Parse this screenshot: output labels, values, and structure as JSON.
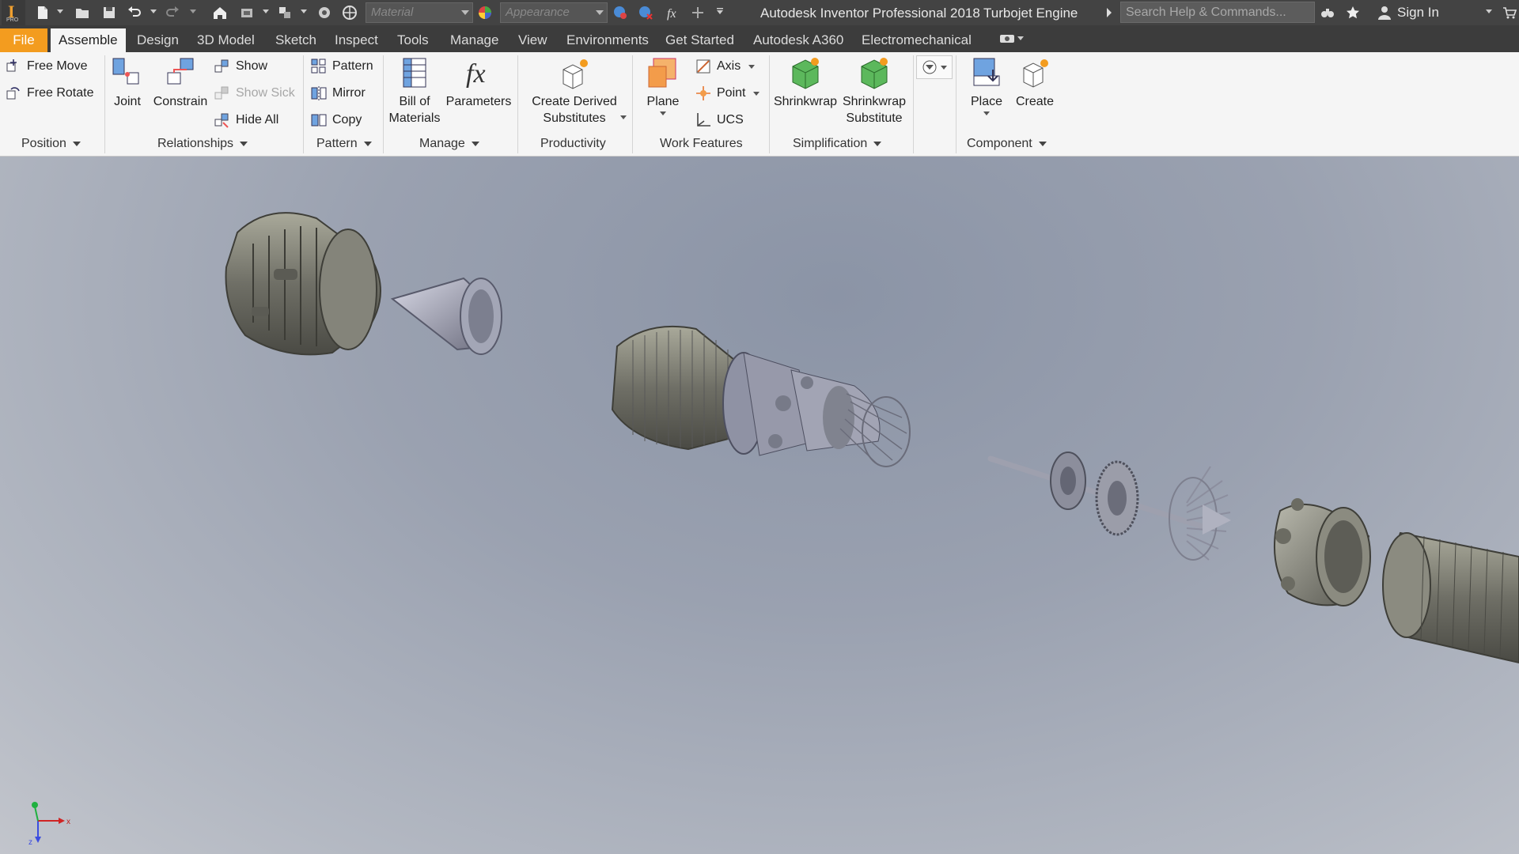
{
  "app": {
    "title": "Autodesk Inventor Professional 2018",
    "document": "Turbojet Engine",
    "logo_letter": "I",
    "logo_sub": "PRO"
  },
  "quick_access": {
    "material_placeholder": "Material",
    "appearance_placeholder": "Appearance",
    "search_placeholder": "Search Help & Commands...",
    "sign_in": "Sign In"
  },
  "tabs": [
    "File",
    "Assemble",
    "Design",
    "3D Model",
    "Sketch",
    "Inspect",
    "Tools",
    "Manage",
    "View",
    "Environments",
    "Get Started",
    "Autodesk A360",
    "Electromechanical"
  ],
  "active_tab": "Assemble",
  "ribbon": {
    "position": {
      "label": "Position",
      "free_move": "Free Move",
      "free_rotate": "Free Rotate"
    },
    "relationships": {
      "label": "Relationships",
      "joint": "Joint",
      "constrain": "Constrain",
      "show": "Show",
      "show_sick": "Show Sick",
      "hide_all": "Hide All"
    },
    "pattern": {
      "label": "Pattern",
      "pattern": "Pattern",
      "mirror": "Mirror",
      "copy": "Copy"
    },
    "manage": {
      "label": "Manage",
      "bom_line1": "Bill of",
      "bom_line2": "Materials",
      "parameters": "Parameters"
    },
    "productivity": {
      "label": "Productivity",
      "cds_line1": "Create Derived",
      "cds_line2": "Substitutes"
    },
    "work_features": {
      "label": "Work Features",
      "plane": "Plane",
      "axis": "Axis",
      "point": "Point",
      "ucs": "UCS"
    },
    "simplification": {
      "label": "Simplification",
      "shrinkwrap": "Shrinkwrap",
      "sws_line1": "Shrinkwrap",
      "sws_line2": "Substitute"
    },
    "component": {
      "label": "Component",
      "place": "Place",
      "create": "Create"
    }
  },
  "triad": {
    "x": "x",
    "z": "z"
  },
  "colors": {
    "file_tab": "#f39c1f",
    "title_bar": "#434343",
    "ribbon_bg": "#f5f5f5"
  }
}
